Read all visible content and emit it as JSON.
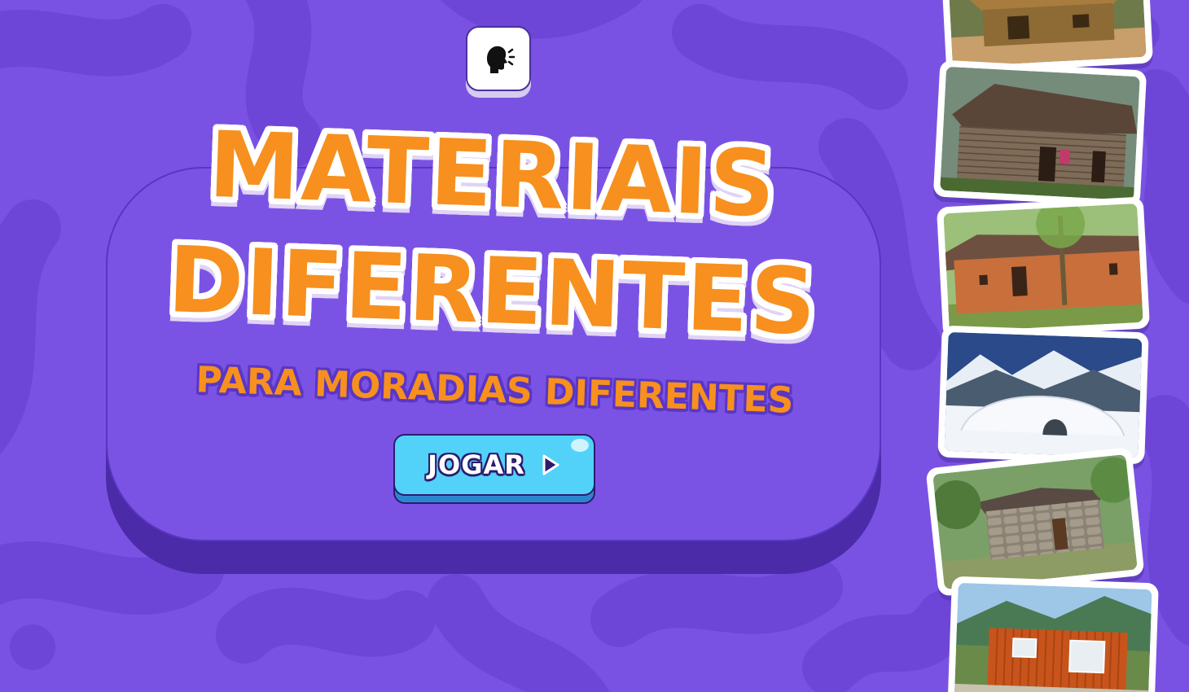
{
  "title": {
    "line1": "MATERIAIS",
    "line2": "DIFERENTES",
    "subtitle": "PARA MORADIAS DIFERENTES"
  },
  "play_button": {
    "label": "JOGAR"
  },
  "icons": {
    "speech": "speaking-head-icon",
    "play": "play-triangle-icon"
  },
  "colors": {
    "background": "#7a52e3",
    "card": "#7b53e4",
    "title_orange": "#f7901e",
    "button_cyan": "#52d2f9"
  },
  "photos": [
    {
      "subject": "straw-hut"
    },
    {
      "subject": "wooden-cabin"
    },
    {
      "subject": "adobe-house"
    },
    {
      "subject": "snow-igloo"
    },
    {
      "subject": "stone-house"
    },
    {
      "subject": "container-house"
    }
  ]
}
